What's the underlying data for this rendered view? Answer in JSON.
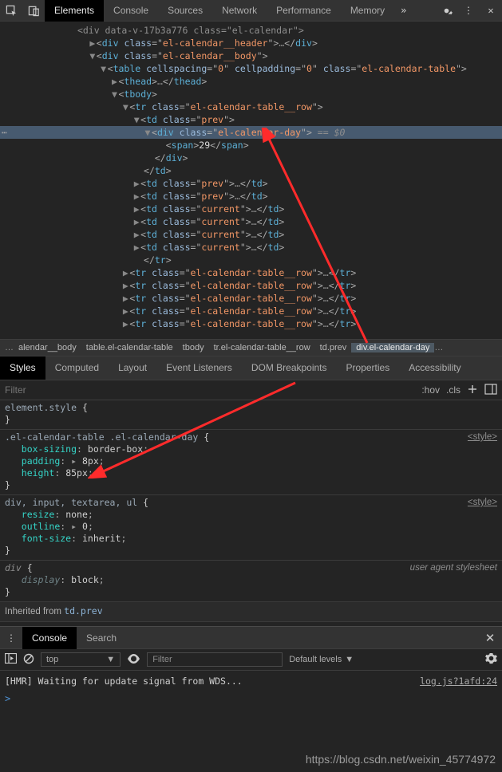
{
  "tabs": {
    "elements": "Elements",
    "console": "Console",
    "sources": "Sources",
    "network": "Network",
    "performance": "Performance",
    "memory": "Memory"
  },
  "dom": {
    "l0a": "<div data-v-17b3a776 class=\"el-calendar\">",
    "l1_open": "<div",
    "l1_attr": "class",
    "l1_val": "el-calendar__header",
    "l1_tail": ">…</div>",
    "l2_open": "<div",
    "l2_attr": "class",
    "l2_val": "el-calendar__body",
    "l2_tail": ">",
    "l3_open": "<table",
    "l3_a1n": "cellspacing",
    "l3_a1v": "0",
    "l3_a2n": "cellpadding",
    "l3_a2v": "0",
    "l3_a3n": "class",
    "l3_a3v": "el-calendar-table",
    "l3_tail": ">",
    "thead": "<thead>…</thead>",
    "tbody_open": "<tbody>",
    "tr_open": "<tr",
    "tr_attr": "class",
    "tr_val": "el-calendar-table__row",
    "tr_tail": ">",
    "td_open": "<td",
    "td_attr": "class",
    "td_prev": "prev",
    "td_current": "current",
    "td_tail": ">",
    "div_open": "<div",
    "div_attr": "class",
    "div_val": "el-calendar-day",
    "div_tail": ">",
    "eq0": " == $0",
    "span_open": "<span>",
    "span_val": "29",
    "span_close": "</span>",
    "div_close": "</div>",
    "td_close": "</td>",
    "td_inline_tail": ">…</td>",
    "tr_close": "</tr>",
    "tr_inline_tail": ">…</tr>"
  },
  "crumbs": {
    "ell": "…",
    "c1": "alendar__body",
    "c2": "table.el-calendar-table",
    "c3": "tbody",
    "c4": "tr.el-calendar-table__row",
    "c5": "td.prev",
    "c6": "div.el-calendar-day"
  },
  "subtabs": {
    "styles": "Styles",
    "computed": "Computed",
    "layout": "Layout",
    "events": "Event Listeners",
    "dombp": "DOM Breakpoints",
    "props": "Properties",
    "a11y": "Accessibility"
  },
  "filter": {
    "placeholder": "Filter",
    "hov": ":hov",
    "cls": ".cls"
  },
  "styles": {
    "r1_sel": "element.style",
    "file": "<style>",
    "r2_sel": ".el-calendar-table .el-calendar-day",
    "r2_p1n": "box-sizing",
    "r2_p1v": "border-box",
    "r2_p2n": "padding",
    "r2_p2v": "8px",
    "r2_p3n": "height",
    "r2_p3v": "85px",
    "r3_sel": "div, input, textarea, ul",
    "r3_p1n": "resize",
    "r3_p1v": "none",
    "r3_p2n": "outline",
    "r3_p2v": "0",
    "r3_p3n": "font-size",
    "r3_p3v": "inherit",
    "r4_sel": "div",
    "r4_ua": "user agent stylesheet",
    "r4_p1n": "display",
    "r4_p1v": "block",
    "inherit": "Inherited from ",
    "inherit_kw": "td.prev"
  },
  "drawer": {
    "console": "Console",
    "search": "Search"
  },
  "console": {
    "top": "top",
    "filter": "Filter",
    "levels": "Default levels",
    "msg": "[HMR] Waiting for update signal from WDS...",
    "src": "log.js?1afd:24",
    "prompt": ">"
  },
  "watermark": "https://blog.csdn.net/weixin_45774972",
  "chart_data": null
}
